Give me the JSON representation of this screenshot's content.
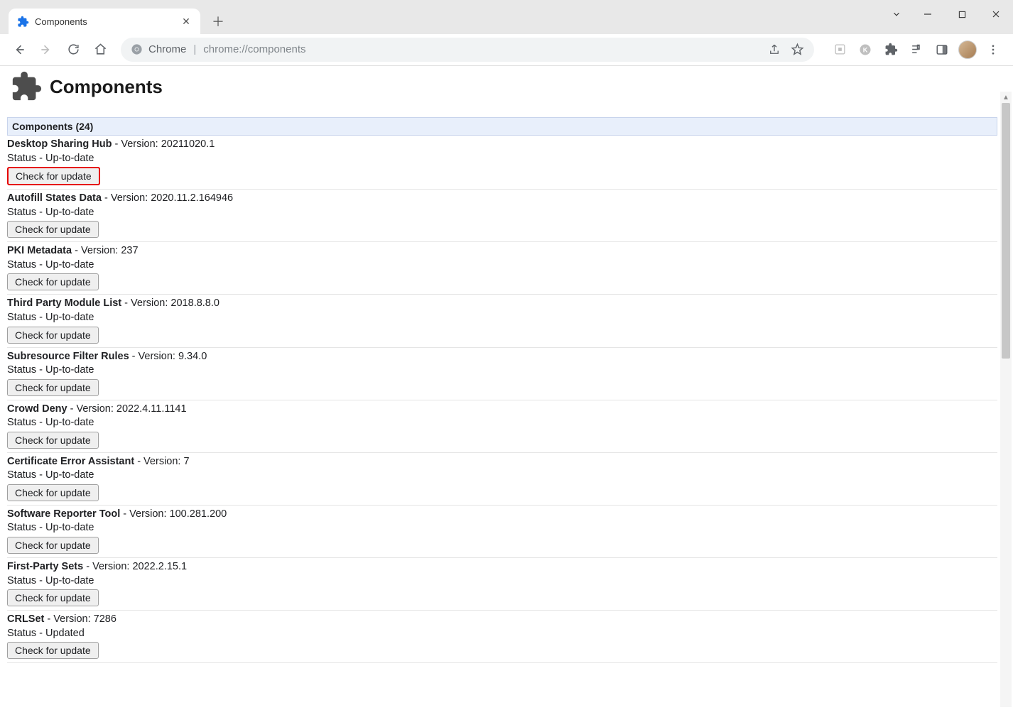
{
  "window": {
    "tab_title": "Components",
    "omnibox_site": "Chrome",
    "omnibox_url": "chrome://components"
  },
  "page": {
    "heading": "Components",
    "list_header": "Components (24)",
    "version_prefix": " - Version: ",
    "status_prefix": "Status - ",
    "check_label": "Check for update"
  },
  "components": [
    {
      "name": "Desktop Sharing Hub",
      "version": "20211020.1",
      "status": "Up-to-date",
      "highlight": true
    },
    {
      "name": "Autofill States Data",
      "version": "2020.11.2.164946",
      "status": "Up-to-date"
    },
    {
      "name": "PKI Metadata",
      "version": "237",
      "status": "Up-to-date"
    },
    {
      "name": "Third Party Module List",
      "version": "2018.8.8.0",
      "status": "Up-to-date"
    },
    {
      "name": "Subresource Filter Rules",
      "version": "9.34.0",
      "status": "Up-to-date"
    },
    {
      "name": "Crowd Deny",
      "version": "2022.4.11.1141",
      "status": "Up-to-date"
    },
    {
      "name": "Certificate Error Assistant",
      "version": "7",
      "status": "Up-to-date"
    },
    {
      "name": "Software Reporter Tool",
      "version": "100.281.200",
      "status": "Up-to-date"
    },
    {
      "name": "First-Party Sets",
      "version": "2022.2.15.1",
      "status": "Up-to-date"
    },
    {
      "name": "CRLSet",
      "version": "7286",
      "status": "Updated"
    }
  ]
}
